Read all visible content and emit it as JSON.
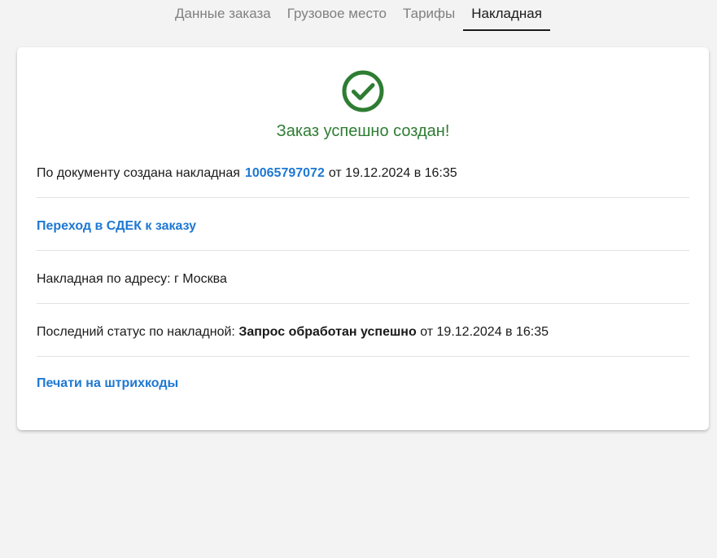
{
  "tabs": [
    {
      "label": "Данные заказа",
      "active": false
    },
    {
      "label": "Грузовое место",
      "active": false
    },
    {
      "label": "Тарифы",
      "active": false
    },
    {
      "label": "Накладная",
      "active": true
    }
  ],
  "success": {
    "icon": "check-circle-icon",
    "color": "#2e7d32",
    "title": "Заказ успешно создан!"
  },
  "invoice": {
    "prefix": "По документу создана накладная",
    "number": "10065797072",
    "suffix": "от 19.12.2024 в 16:35"
  },
  "cdek_link": "Переход в СДЕК к заказу",
  "address": {
    "text": "Накладная по адресу: г Москва"
  },
  "status": {
    "prefix": "Последний статус по накладной:",
    "value": "Запрос обработан успешно",
    "suffix": "от 19.12.2024 в 16:35"
  },
  "barcode_link": "Печати на штрихкоды",
  "colors": {
    "link": "#1e78d2",
    "success": "#2e7d32",
    "background": "#f3f3f3"
  }
}
